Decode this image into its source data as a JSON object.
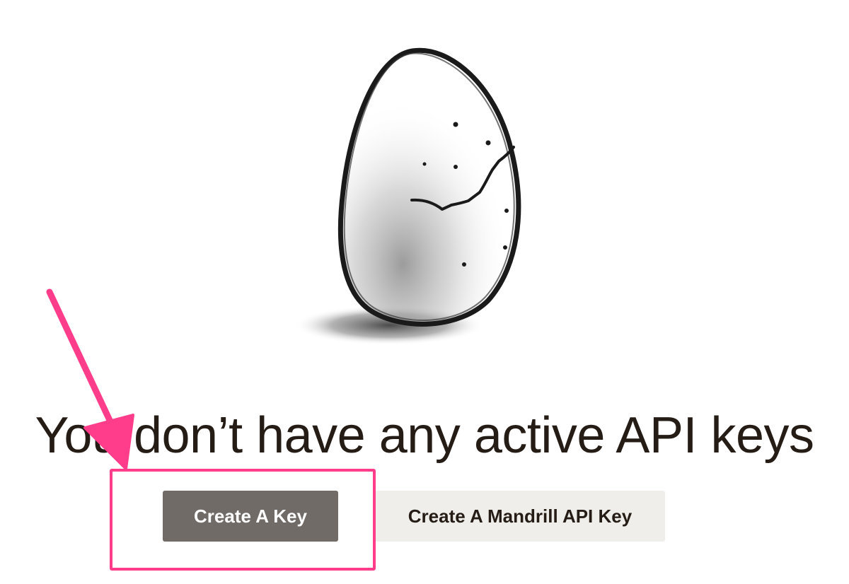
{
  "empty_state": {
    "heading": "You don’t have any active API keys",
    "illustration": "cracked-egg-illustration"
  },
  "actions": {
    "create_key_label": "Create A Key",
    "create_mandrill_key_label": "Create A Mandrill API Key"
  },
  "annotation": {
    "highlight_target": "create-key-button",
    "color": "#ff3d8b"
  },
  "colors": {
    "primary_button": "#716b67",
    "secondary_button": "#efeeea",
    "text": "#241c15"
  }
}
